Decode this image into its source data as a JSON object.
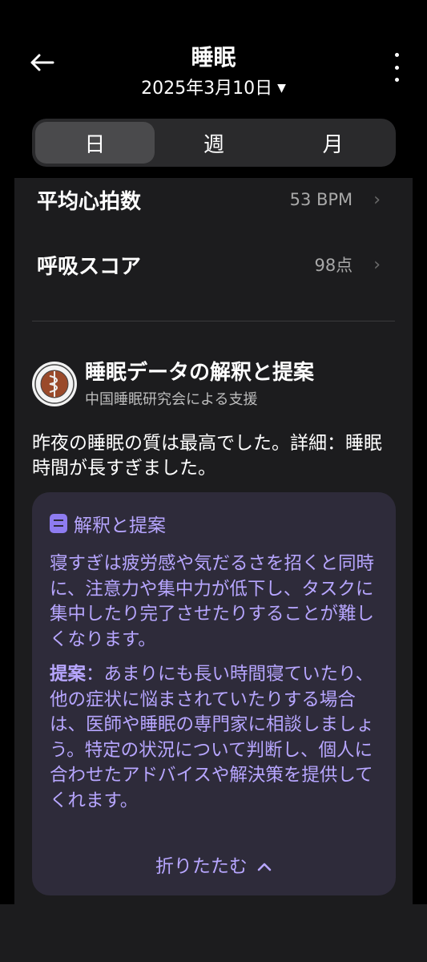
{
  "header": {
    "title": "睡眠",
    "date": "2025年3月10日",
    "back_icon": "arrow-left-icon",
    "more_icon": "more-vertical-icon"
  },
  "tabs": [
    {
      "label": "日",
      "active": true
    },
    {
      "label": "週",
      "active": false
    },
    {
      "label": "月",
      "active": false
    }
  ],
  "metrics": [
    {
      "label": "平均心拍数",
      "value": "53 BPM"
    },
    {
      "label": "呼吸スコア",
      "value": "98点"
    }
  ],
  "insight": {
    "title": "睡眠データの解釈と提案",
    "subtitle": "中国睡眠研究会による支援",
    "summary": "昨夜の睡眠の質は最高でした。詳細：睡眠時間が長すぎました。",
    "advice_title": "解釈と提案",
    "advice_body": "寝すぎは疲労感や気だるさを招くと同時に、注意力や集中力が低下し、タスクに集中したり完了させたりすることが難しくなります。",
    "suggestion_label": "提案",
    "suggestion_body": "：あまりにも長い時間寝ていたり、他の症状に悩まされていたりする場合は、医師や睡眠の専門家に相談しましょう。特定の状況について判断し、個人に合わせたアドバイスや解決策を提供してくれます。",
    "collapse_label": "折りたたむ"
  },
  "colors": {
    "accent": "#b7a6ff",
    "card": "#1c1c1e",
    "advice_bg": "#2e2b3a"
  }
}
